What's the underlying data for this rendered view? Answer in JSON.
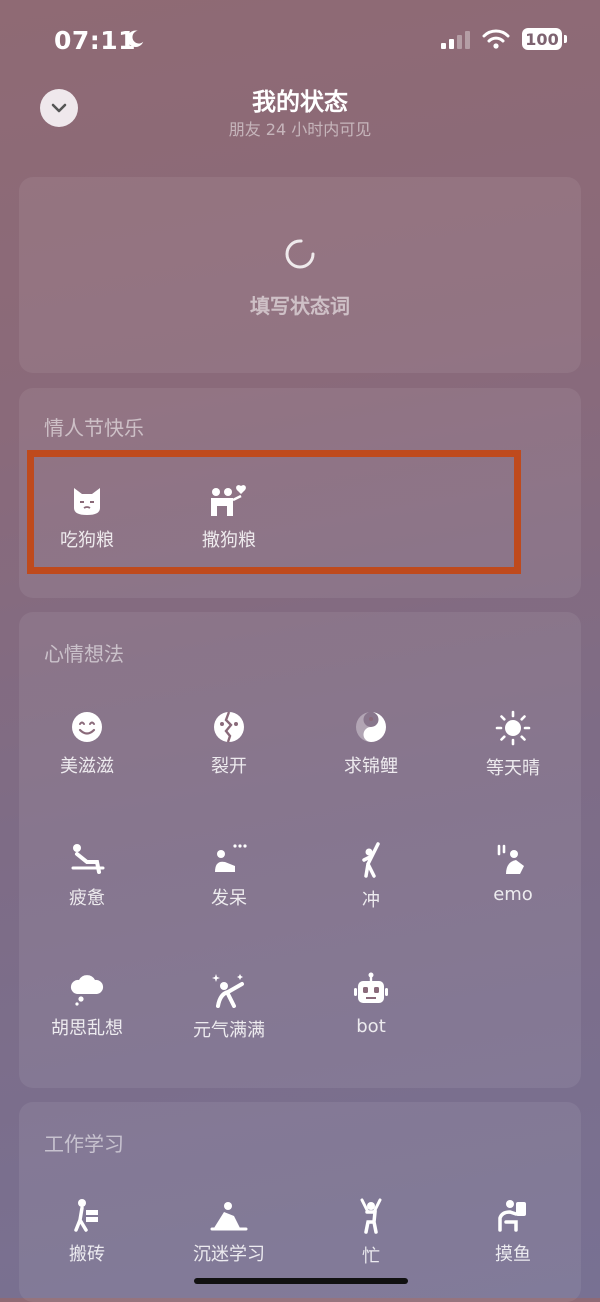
{
  "status_bar": {
    "time": "07:11",
    "battery": "100"
  },
  "header": {
    "title": "我的状态",
    "subtitle": "朋友 24 小时内可见"
  },
  "status_input": {
    "placeholder": "填写状态词"
  },
  "sections": {
    "valentine": {
      "title": "情人节快乐",
      "items": [
        {
          "label": "吃狗粮",
          "icon": "cat-icon"
        },
        {
          "label": "撒狗粮",
          "icon": "couple-heart-icon"
        }
      ]
    },
    "mood": {
      "title": "心情想法",
      "items": [
        {
          "label": "美滋滋",
          "icon": "smile-icon"
        },
        {
          "label": "裂开",
          "icon": "cracked-face-icon"
        },
        {
          "label": "求锦鲤",
          "icon": "koi-icon"
        },
        {
          "label": "等天晴",
          "icon": "sun-icon"
        },
        {
          "label": "疲惫",
          "icon": "tired-person-icon"
        },
        {
          "label": "发呆",
          "icon": "daze-person-icon"
        },
        {
          "label": "冲",
          "icon": "cheer-person-icon"
        },
        {
          "label": "emo",
          "icon": "sad-person-icon"
        },
        {
          "label": "胡思乱想",
          "icon": "thought-cloud-icon"
        },
        {
          "label": "元气满满",
          "icon": "energetic-person-icon"
        },
        {
          "label": "bot",
          "icon": "robot-icon"
        }
      ]
    },
    "work": {
      "title": "工作学习",
      "items": [
        {
          "label": "搬砖",
          "icon": "brick-carrier-icon"
        },
        {
          "label": "沉迷学习",
          "icon": "study-icon"
        },
        {
          "label": "忙",
          "icon": "busy-person-icon"
        },
        {
          "label": "摸鱼",
          "icon": "slacking-icon"
        }
      ]
    }
  },
  "colors": {
    "highlight": "#bf4a1d",
    "back_button_bg": "#efe8ec"
  }
}
